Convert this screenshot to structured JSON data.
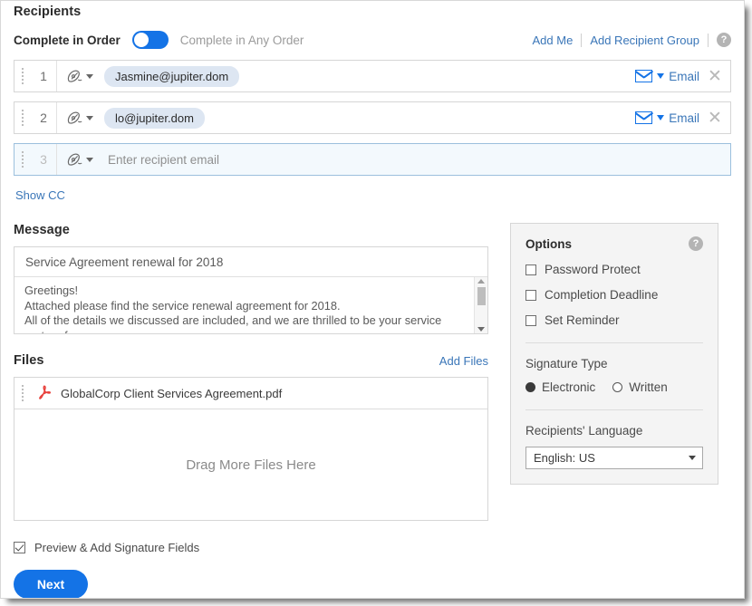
{
  "recipients": {
    "title": "Recipients",
    "complete_in_order_label": "Complete in Order",
    "complete_in_any_order_label": "Complete in Any Order",
    "toggle_state": "on",
    "add_me_label": "Add Me",
    "add_recipient_group_label": "Add Recipient Group",
    "help_glyph": "?",
    "rows": [
      {
        "number": "1",
        "email": "Jasmine@jupiter.dom",
        "delivery": "Email",
        "remove_glyph": "✕",
        "empty": false
      },
      {
        "number": "2",
        "email": "lo@jupiter.dom",
        "delivery": "Email",
        "remove_glyph": "✕",
        "empty": false
      },
      {
        "number": "3",
        "placeholder": "Enter recipient email",
        "empty": true
      }
    ],
    "show_cc_label": "Show CC"
  },
  "message": {
    "title": "Message",
    "subject": "Service Agreement renewal for 2018",
    "body_lines": [
      "Greetings!",
      "Attached please find the service renewal agreement for 2018.",
      "All of the details we discussed are included, and we are thrilled to be your service partner for"
    ]
  },
  "files": {
    "title": "Files",
    "add_files_label": "Add Files",
    "items": [
      {
        "name": "GlobalCorp Client Services Agreement.pdf",
        "type": "pdf"
      }
    ],
    "drop_label": "Drag More Files Here"
  },
  "options": {
    "title": "Options",
    "help_glyph": "?",
    "checkboxes": [
      {
        "label": "Password Protect",
        "checked": false
      },
      {
        "label": "Completion Deadline",
        "checked": false
      },
      {
        "label": "Set Reminder",
        "checked": false
      }
    ],
    "signature_type_label": "Signature Type",
    "signature_options": [
      {
        "label": "Electronic",
        "selected": true
      },
      {
        "label": "Written",
        "selected": false
      }
    ],
    "language_label": "Recipients' Language",
    "language_value": "English: US"
  },
  "footer": {
    "preview_label": "Preview & Add Signature Fields",
    "preview_checked": true,
    "next_label": "Next"
  },
  "colors": {
    "accent_blue": "#1473e6",
    "link_blue": "#3a76b8",
    "chip_bg": "#dde6f2",
    "panel_bg": "#f4f4f4",
    "pdf_red": "#e8413c"
  }
}
